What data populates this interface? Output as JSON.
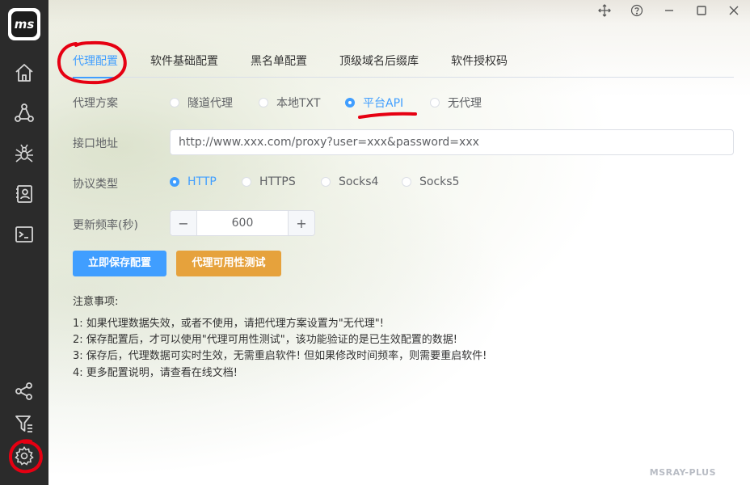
{
  "app": {
    "logo_text": "ms",
    "watermark": "MSRAY-PLUS"
  },
  "sidebar": {
    "items": [
      {
        "name": "home-icon"
      },
      {
        "name": "network-icon"
      },
      {
        "name": "spider-icon"
      },
      {
        "name": "contacts-icon"
      },
      {
        "name": "terminal-icon"
      },
      {
        "name": "share-icon"
      },
      {
        "name": "filter-icon"
      },
      {
        "name": "gear-icon",
        "active": true
      }
    ]
  },
  "tabs": [
    {
      "label": "代理配置",
      "active": true
    },
    {
      "label": "软件基础配置"
    },
    {
      "label": "黑名单配置"
    },
    {
      "label": "顶级域名后缀库"
    },
    {
      "label": "软件授权码"
    }
  ],
  "form": {
    "proxy_mode": {
      "label": "代理方案",
      "options": [
        "隧道代理",
        "本地TXT",
        "平台API",
        "无代理"
      ],
      "selected": "平台API"
    },
    "api_url": {
      "label": "接口地址",
      "value": "http://www.xxx.com/proxy?user=xxx&password=xxx"
    },
    "protocol": {
      "label": "协议类型",
      "options": [
        "HTTP",
        "HTTPS",
        "Socks4",
        "Socks5"
      ],
      "selected": "HTTP"
    },
    "refresh": {
      "label": "更新频率(秒)",
      "value": "600",
      "minus": "−",
      "plus": "+"
    }
  },
  "buttons": {
    "save": "立即保存配置",
    "test": "代理可用性测试"
  },
  "notes": {
    "title": "注意事项:",
    "items": [
      "1: 如果代理数据失效，或者不使用，请把代理方案设置为\"无代理\"!",
      "2: 保存配置后，才可以使用\"代理可用性测试\"，该功能验证的是已生效配置的数据!",
      "3: 保存后，代理数据可实时生效，无需重启软件! 但如果修改时间频率，则需要重启软件!",
      "4: 更多配置说明，请查看在线文档!"
    ]
  },
  "colors": {
    "accent": "#409eff",
    "warning": "#e6a23c",
    "sidebar": "#2b2b2b",
    "annotation": "#e60012"
  }
}
